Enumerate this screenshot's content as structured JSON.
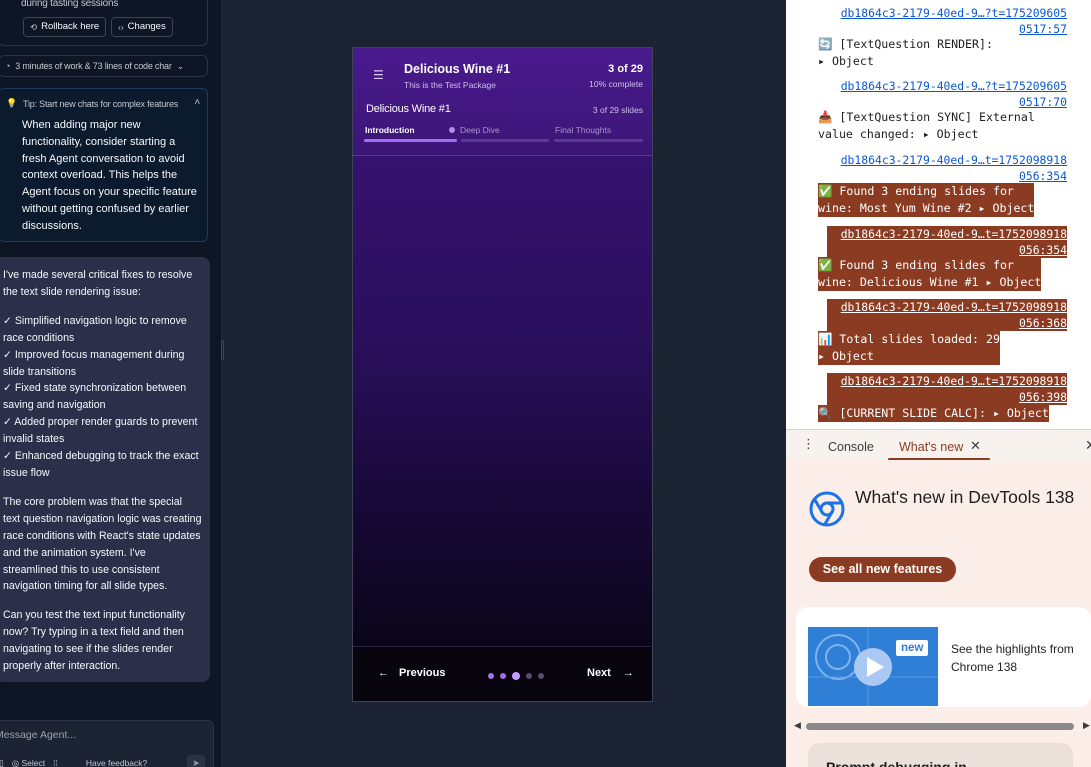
{
  "agent": {
    "top_card": {
      "subtitle": "during tasting sessions",
      "rollback_label": "Rollback here",
      "changes_label": "Changes"
    },
    "stats": "3 minutes of work & 73 lines of code char",
    "tip": {
      "title": "Tip: Start new chats for complex features",
      "body": "When adding major new functionality, consider starting a fresh Agent conversation to avoid context overload. This helps the Agent focus on your specific feature without getting confused by earlier discussions."
    },
    "message": {
      "intro": "I've made several critical fixes to resolve the text slide rendering issue:",
      "fixes": [
        "✓ Simplified navigation logic to remove race conditions",
        "✓ Improved focus management during slide transitions",
        "✓ Fixed state synchronization between saving and navigation",
        "✓ Added proper render guards to prevent invalid states",
        "✓ Enhanced debugging to track the exact issue flow"
      ],
      "core": "The core problem was that the special text question navigation logic was creating race conditions with React's state updates and the animation system. I've streamlined this to use consistent navigation timing for all slide types.",
      "ask": "Can you test the text input functionality now? Try typing in a text field and then navigating to see if the slides render properly after interaction."
    },
    "input": {
      "placeholder": "Message Agent...",
      "select_label": "Select",
      "feedback_label": "Have feedback?"
    }
  },
  "preview": {
    "title": "Delicious Wine #1",
    "subtitle": "This is the Test Package",
    "count": "3 of 29",
    "percent": "10% complete",
    "section_title": "Delicious Wine #1",
    "slides_count": "3 of 29 slides",
    "sections": [
      "Introduction",
      "Deep Dive",
      "Final Thoughts"
    ],
    "section_progress": [
      1,
      0,
      0
    ],
    "prev_label": "Previous",
    "next_label": "Next",
    "dots_total": 5,
    "dots_current": 3
  },
  "devtools": {
    "logs": [
      {
        "type": "link",
        "text": "db1864c3-2179-40ed-9…?t=175209605\n0517:57"
      },
      {
        "type": "line",
        "text": "🔄 [TextQuestion RENDER]:\n▸ Object"
      },
      {
        "type": "link",
        "text": "db1864c3-2179-40ed-9…?t=175209605\n0517:70"
      },
      {
        "type": "line",
        "text": "📥 [TextQuestion SYNC] External\nvalue changed: ▸ Object"
      },
      {
        "type": "link",
        "text": "db1864c3-2179-40ed-9…t=1752098918\n056:354"
      },
      {
        "type": "hl",
        "text": "✅ Found 3 ending slides for\nwine: Most Yum Wine #2 ▸ Object"
      },
      {
        "type": "hllink",
        "text": "db1864c3-2179-40ed-9…t=1752098918\n056:354"
      },
      {
        "type": "hl",
        "text": "✅ Found 3 ending slides for\nwine: Delicious Wine #1 ▸ Object"
      },
      {
        "type": "hllink",
        "text": "db1864c3-2179-40ed-9…t=1752098918\n056:368"
      },
      {
        "type": "hl",
        "text": "📊 Total slides loaded: 29\n▸ Object"
      },
      {
        "type": "hllink",
        "text": "db1864c3-2179-40ed-9…t=1752098918\n056:398"
      },
      {
        "type": "hl",
        "text": "🔍 [CURRENT SLIDE CALC]: ▸ Object"
      }
    ],
    "tabs": [
      "Console",
      "What's new"
    ],
    "whats_new_title": "What's new in DevTools 138",
    "see_all_label": "See all new features",
    "highlight_badge": "new",
    "highlight_text": "See the highlights from Chrome 138",
    "bottom_card_text": "Prompt debugging in..."
  }
}
